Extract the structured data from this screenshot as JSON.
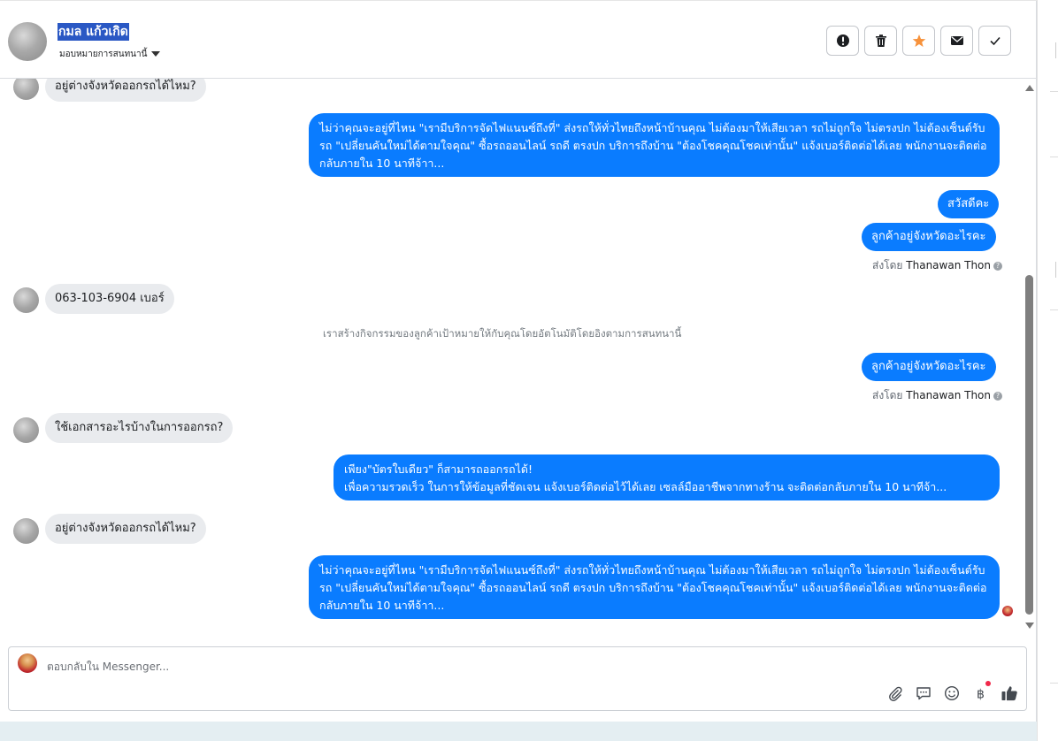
{
  "header": {
    "contact_name": "กมล แก้วเกิด",
    "assign_label": "มอบหมายการสนทนานี้",
    "buttons": [
      {
        "name": "mark-spam-button",
        "icon": "exclamation-circle-icon"
      },
      {
        "name": "delete-button",
        "icon": "trash-icon"
      },
      {
        "name": "star-button",
        "icon": "star-icon",
        "color": "#f7923b"
      },
      {
        "name": "mark-unread-button",
        "icon": "envelope-icon"
      },
      {
        "name": "mark-done-button",
        "icon": "check-icon"
      }
    ]
  },
  "messages": {
    "m1": "อยู่ต่างจังหวัดออกรถได้ไหม?",
    "m2": "ไม่ว่าคุณจะอยู่ที่ไหน \"เรามีบริการจัดไฟแนนซ์ถึงที่\"  ส่งรถให้ทั่วไทยถึงหน้าบ้านคุณ ไม่ต้องมาให้เสียเวลา รถไม่ถูกใจ ไม่ตรงปก ไม่ต้องเซ็นต์รับรถ \"เปลี่ยนคันใหม่ได้ตามใจคุณ\" ซื้อรถออนไลน์ รถดี ตรงปก บริการถึงบ้าน \"ต้องโชคคุณโชคเท่านั้น\" แจ้งเบอร์ติดต่อได้เลย พนักงานจะติดต่อกลับภายใน 10 นาทีจ้าา...",
    "m3": "สวัสดีคะ",
    "m4": "ลูกค้าอยู่จังหวัดอะไรคะ",
    "sent_by_prefix": "ส่งโดย",
    "sent_by_name": "Thanawan Thon",
    "m5": "063-103-6904 เบอร์",
    "system_note": "เราสร้างกิจกรรมของลูกค้าเป้าหมายให้กับคุณโดยอัตโนมัติโดยอิงตามการสนทนานี้",
    "m6": "ลูกค้าอยู่จังหวัดอะไรคะ",
    "m7": "ใช้เอกสารอะไรบ้างในการออกรถ?",
    "m8_line1": "เพียง\"บัตรใบเดียว\" ก็สามารถออกรถได้!",
    "m8_line2": "เพื่อความรวดเร็ว ในการให้ข้อมูลที่ชัดเจน แจ้งเบอร์ติดต่อไว้ได้เลย เซลล์มืออาชีพจากทางร้าน จะติดต่อกลับภายใน 10 นาทีจ้า...",
    "m9": "อยู่ต่างจังหวัดออกรถได้ไหม?",
    "m10": "ไม่ว่าคุณจะอยู่ที่ไหน \"เรามีบริการจัดไฟแนนซ์ถึงที่\"  ส่งรถให้ทั่วไทยถึงหน้าบ้านคุณ ไม่ต้องมาให้เสียเวลา รถไม่ถูกใจ ไม่ตรงปก ไม่ต้องเซ็นต์รับรถ \"เปลี่ยนคันใหม่ได้ตามใจคุณ\" ซื้อรถออนไลน์ รถดี ตรงปก บริการถึงบ้าน \"ต้องโชคคุณโชคเท่านั้น\" แจ้งเบอร์ติดต่อได้เลย พนักงานจะติดต่อกลับภายใน 10 นาทีจ้าา..."
  },
  "composer": {
    "placeholder": "ตอบกลับใน Messenger...",
    "icons": [
      "paperclip-icon",
      "saved-reply-icon",
      "emoji-icon",
      "baht-payment-icon",
      "like-icon"
    ]
  },
  "colors": {
    "outgoing_bubble": "#0a7cff",
    "incoming_bubble": "#e9ebee",
    "name_highlight": "#2a58c4",
    "like_icon": "#444950"
  }
}
